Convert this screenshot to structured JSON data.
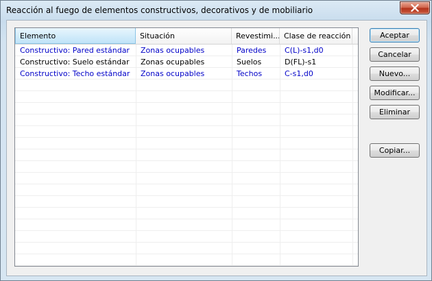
{
  "window": {
    "title": "Reacción al fuego de elementos constructivos, decorativos y de mobiliario"
  },
  "list": {
    "columns": [
      "Elemento",
      "Situación",
      "Revestimi...",
      "Clase de reacción"
    ],
    "rows": [
      {
        "elemento": "Constructivo: Pared estándar",
        "situacion": "Zonas ocupables",
        "revestimiento": "Paredes",
        "clase": "C(L)-s1,d0",
        "color": "#0000c8"
      },
      {
        "elemento": "Constructivo: Suelo estándar",
        "situacion": "Zonas ocupables",
        "revestimiento": "Suelos",
        "clase": "D(FL)-s1",
        "color": "#000000"
      },
      {
        "elemento": "Constructivo: Techo estándar",
        "situacion": "Zonas ocupables",
        "revestimiento": "Techos",
        "clase": "C-s1,d0",
        "color": "#0000c8"
      }
    ]
  },
  "buttons": {
    "accept": "Aceptar",
    "cancel": "Cancelar",
    "new": "Nuevo...",
    "modify": "Modificar...",
    "delete": "Eliminar",
    "copy": "Copiar..."
  },
  "icons": {
    "close": "close-icon"
  }
}
